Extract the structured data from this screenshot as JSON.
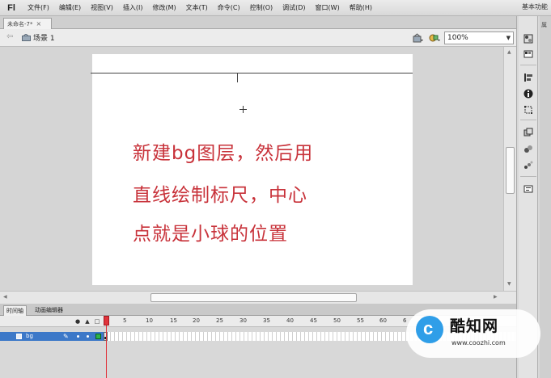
{
  "app": {
    "logo": "Fl"
  },
  "menubar": {
    "items": [
      "文件(F)",
      "编辑(E)",
      "视图(V)",
      "插入(I)",
      "修改(M)",
      "文本(T)",
      "命令(C)",
      "控制(O)",
      "调试(D)",
      "窗口(W)",
      "帮助(H)"
    ],
    "workspace": "基本功能"
  },
  "document_tab": {
    "label": "未命名-7*",
    "close": "×"
  },
  "scene_bar": {
    "back_icon": "arrow-left-icon",
    "scene_label": "场景 1",
    "zoom": "100%"
  },
  "stage": {
    "annotation_lines": [
      "新建bg图层，然后用",
      "直线绘制标尺，中心",
      "点就是小球的位置"
    ],
    "annotation_color": "#c8323a"
  },
  "timeline": {
    "tabs": [
      "时间轴",
      "动画编辑器"
    ],
    "frame_numbers": [
      "5",
      "10",
      "15",
      "20",
      "25",
      "30",
      "35",
      "40",
      "45",
      "50",
      "55",
      "60",
      "6"
    ],
    "layer": {
      "name": "bg",
      "selected_color": "#3c78c8"
    },
    "playhead_color": "#e0333b"
  },
  "right_panel": {
    "title": "属"
  },
  "watermark": {
    "title": "酷知网",
    "url": "www.coozhi.com",
    "logo_letter": "c"
  }
}
